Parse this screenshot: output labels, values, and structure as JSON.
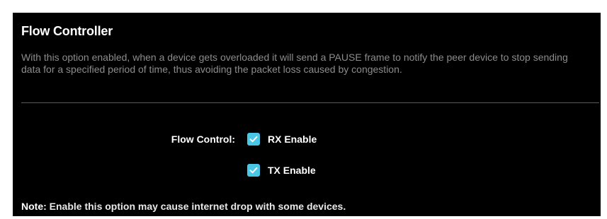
{
  "section": {
    "title": "Flow Controller",
    "description": "With this option enabled, when a device gets overloaded it will send a PAUSE frame to notify the peer device to stop sending data for a specified period of time, thus avoiding the packet loss caused by congestion."
  },
  "flow_control": {
    "label": "Flow Control:",
    "options": [
      {
        "label": "RX Enable",
        "checked": true,
        "icon": "checkmark-icon"
      },
      {
        "label": "TX Enable",
        "checked": true,
        "icon": "checkmark-icon"
      }
    ]
  },
  "note": {
    "prefix": "Note:",
    "text": " Enable this option may cause internet drop with some devices."
  },
  "colors": {
    "background": "#000000",
    "checkbox_accent": "#4ac6e6",
    "description_text": "#8c8c8c",
    "divider": "#5a5a5a"
  }
}
